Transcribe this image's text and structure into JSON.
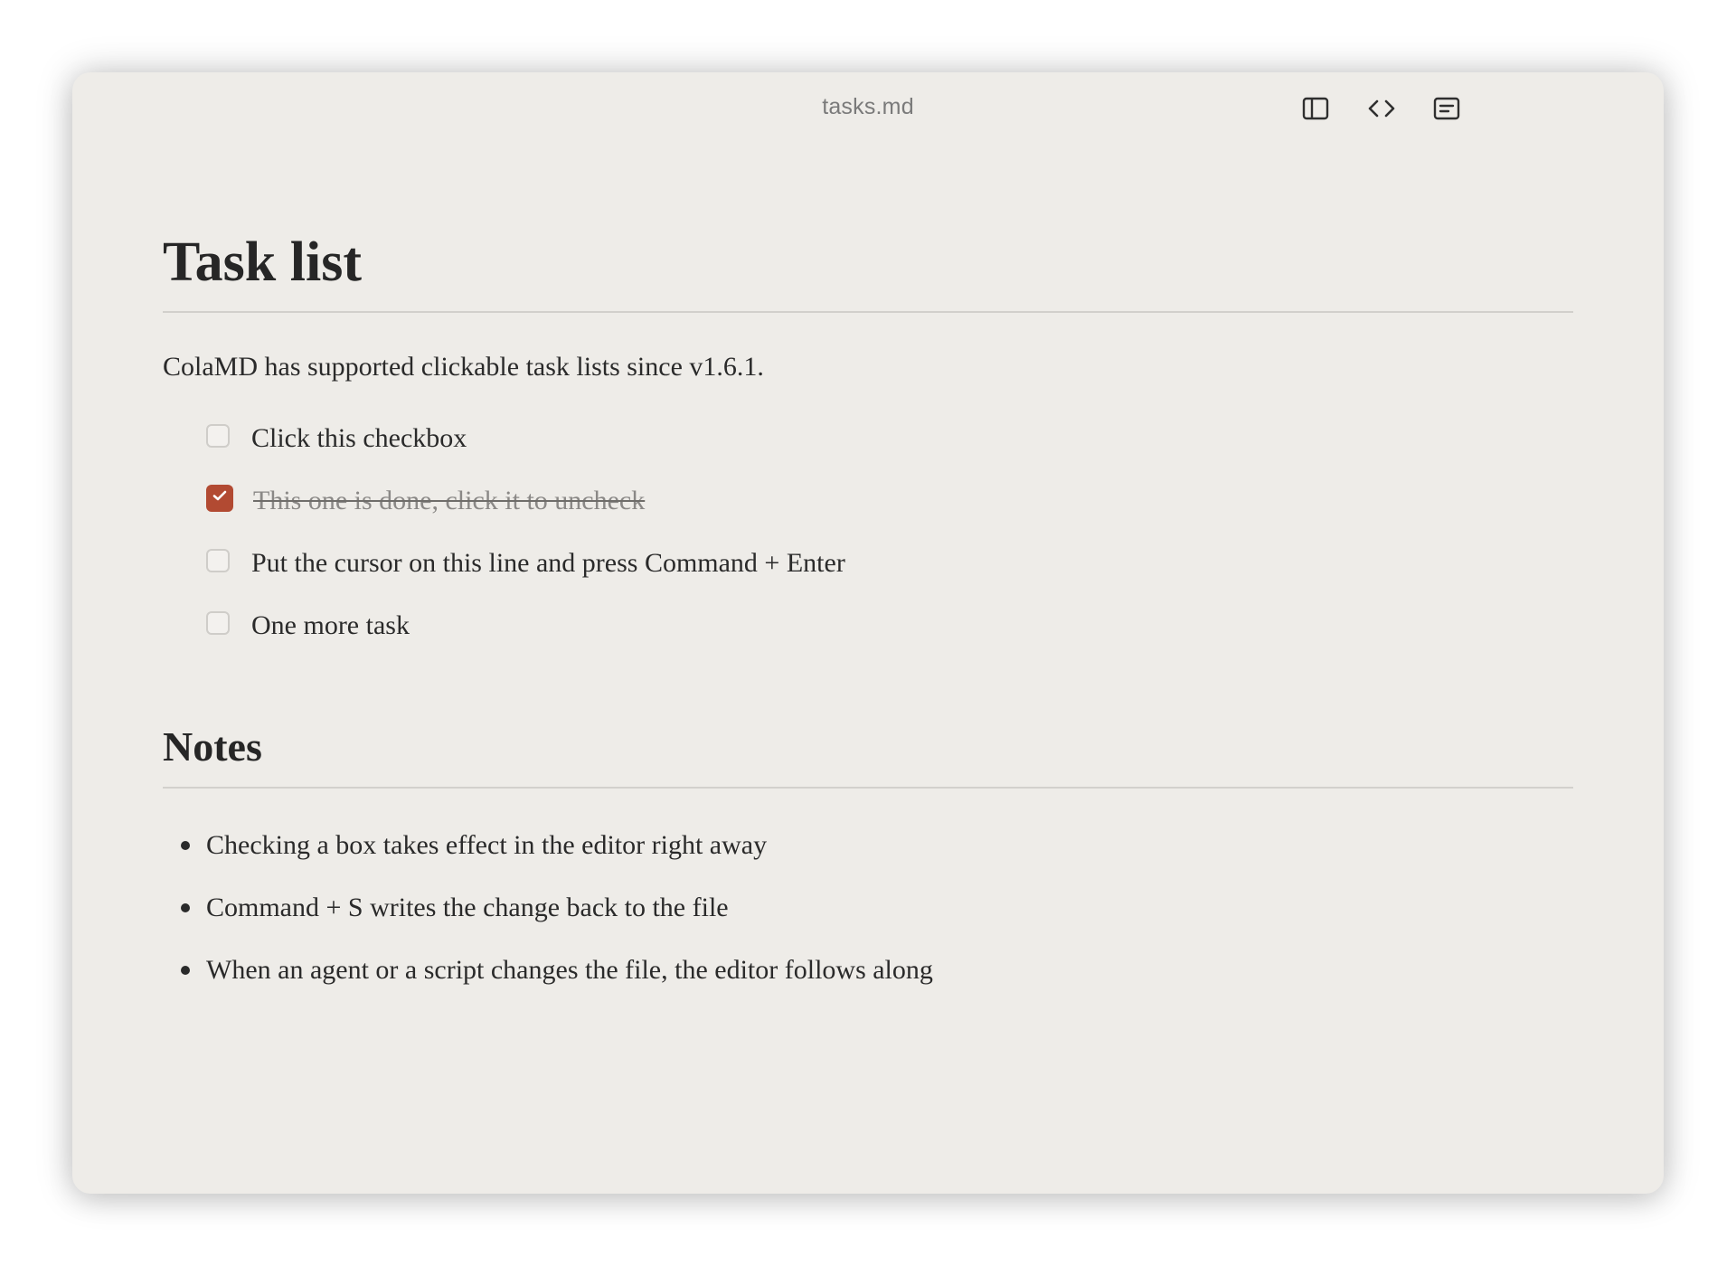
{
  "window": {
    "title": "tasks.md"
  },
  "toolbar": {
    "sidebar_toggle": "sidebar-toggle-icon",
    "source_view": "code-brackets-icon",
    "outline_view": "outline-icon"
  },
  "doc": {
    "heading": "Task list",
    "intro": "ColaMD has supported clickable task lists since v1.6.1.",
    "tasks": [
      {
        "label": "Click this checkbox",
        "checked": false
      },
      {
        "label": "This one is done, click it to uncheck",
        "checked": true
      },
      {
        "label": "Put the cursor on this line and press Command + Enter",
        "checked": false
      },
      {
        "label": "One more task",
        "checked": false
      }
    ],
    "notes_heading": "Notes",
    "notes": [
      "Checking a box takes effect in the editor right away",
      "Command + S writes the change back to the file",
      "When an agent or a script changes the file, the editor follows along"
    ]
  },
  "colors": {
    "accent": "#b24a32",
    "background": "#eeece8",
    "text": "#2a2a2a"
  }
}
